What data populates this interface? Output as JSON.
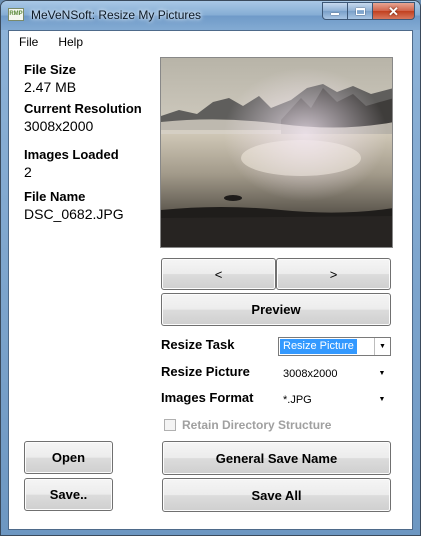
{
  "window": {
    "title": "MeVeNSoft: Resize My Pictures",
    "icon_text": "RMP"
  },
  "menu": {
    "file": "File",
    "help": "Help"
  },
  "info": {
    "file_size_label": "File Size",
    "file_size_value": "2.47 MB",
    "resolution_label": "Current Resolution",
    "resolution_value": "3008x2000",
    "images_loaded_label": "Images Loaded",
    "images_loaded_value": "2",
    "file_name_label": "File Name",
    "file_name_value": "DSC_0682.JPG"
  },
  "nav": {
    "prev": "<",
    "next": ">"
  },
  "buttons": {
    "preview": "Preview",
    "open": "Open",
    "save": "Save..",
    "general_save_name": "General Save Name",
    "save_all": "Save All"
  },
  "form": {
    "resize_task_label": "Resize Task",
    "resize_task_value": "Resize Picture",
    "resize_picture_label": "Resize Picture",
    "resize_picture_value": "3008x2000",
    "images_format_label": "Images Format",
    "images_format_value": "*.JPG",
    "retain_label": "Retain Directory Structure"
  }
}
